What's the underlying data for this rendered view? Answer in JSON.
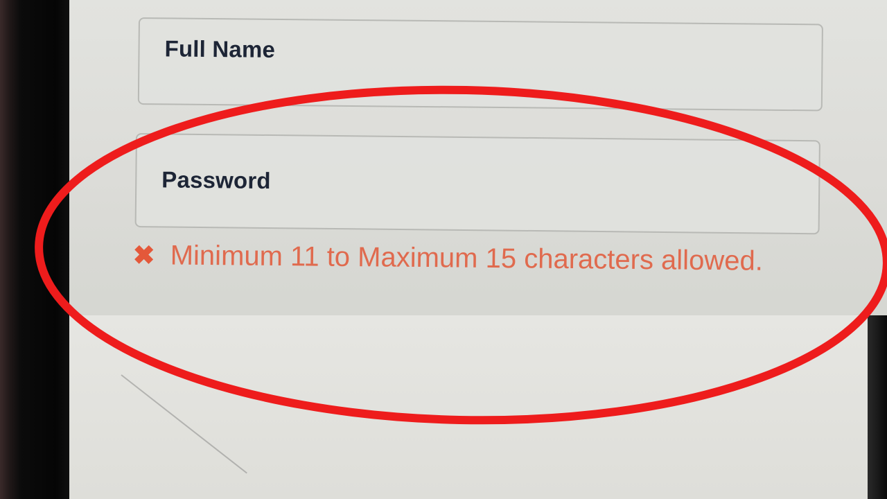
{
  "form": {
    "full_name_label": "Full Name",
    "password_label": "Password",
    "error": {
      "icon": "close-icon",
      "message": "Minimum 11 to Maximum 15 characters allowed."
    }
  },
  "annotation": {
    "highlight_color": "#ee1c1c"
  }
}
